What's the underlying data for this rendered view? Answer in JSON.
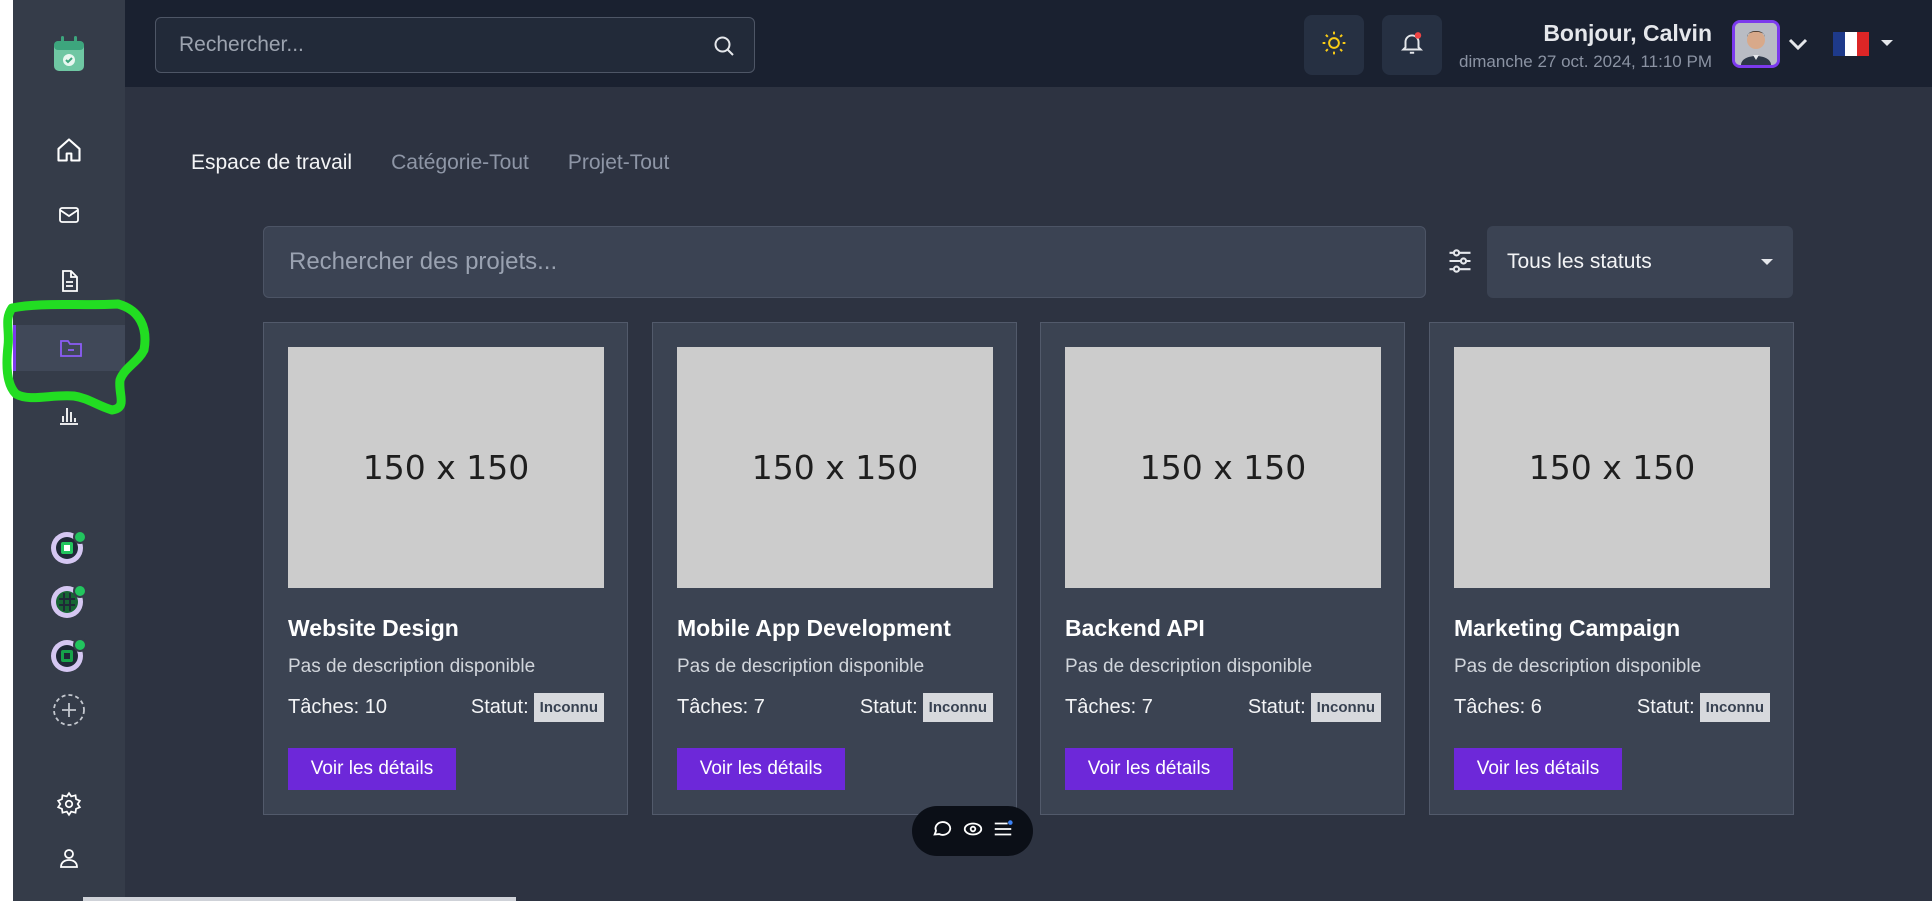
{
  "header": {
    "search_placeholder": "Rechercher...",
    "greeting": "Bonjour, Calvin",
    "datetime": "dimanche 27 oct. 2024, 11:10 PM",
    "theme_icon": "sun-icon",
    "notification_icon": "bell-icon",
    "language": "fr"
  },
  "sidebar": {
    "items": [
      "home-icon",
      "mail-icon",
      "document-icon",
      "folder-icon",
      "chart-icon"
    ],
    "active": "folder-icon",
    "workspaces": [
      "workspace-1",
      "workspace-2",
      "workspace-3"
    ],
    "bottom": [
      "settings-icon",
      "user-icon"
    ]
  },
  "tabs": [
    {
      "label": "Espace de travail",
      "active": true
    },
    {
      "label": "Catégorie-Tout",
      "active": false
    },
    {
      "label": "Projet-Tout",
      "active": false
    }
  ],
  "project_search": {
    "placeholder": "Rechercher des projets..."
  },
  "status_filter": {
    "selected": "Tous les statuts"
  },
  "projects": [
    {
      "image": "150 x 150",
      "title": "Website Design",
      "description": "Pas de description disponible",
      "tasks": "Tâches: 10",
      "status_label": "Statut:",
      "status": "Inconnu",
      "button": "Voir les détails"
    },
    {
      "image": "150 x 150",
      "title": "Mobile App Development",
      "description": "Pas de description disponible",
      "tasks": "Tâches: 7",
      "status_label": "Statut:",
      "status": "Inconnu",
      "button": "Voir les détails"
    },
    {
      "image": "150 x 150",
      "title": "Backend API",
      "description": "Pas de description disponible",
      "tasks": "Tâches: 7",
      "status_label": "Statut:",
      "status": "Inconnu",
      "button": "Voir les détails"
    },
    {
      "image": "150 x 150",
      "title": "Marketing Campaign",
      "description": "Pas de description disponible",
      "tasks": "Tâches: 6",
      "status_label": "Statut:",
      "status": "Inconnu",
      "button": "Voir les détails"
    }
  ],
  "colors": {
    "accent": "#7c3aed",
    "button": "#6d28d9",
    "annotation": "#22dd22"
  }
}
